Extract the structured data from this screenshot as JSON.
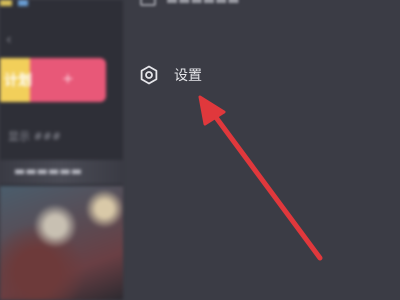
{
  "left_panel": {
    "back_glyph": "‹",
    "banner_text": "计划",
    "banner_plus": "+",
    "section_label": "显示 ###",
    "row_text": "▬▬▬▬▬▬"
  },
  "top_item": {
    "label": "■■■■■■"
  },
  "menu": {
    "settings_label": "设置"
  },
  "annotation": {
    "arrow_color": "#e0383c"
  }
}
